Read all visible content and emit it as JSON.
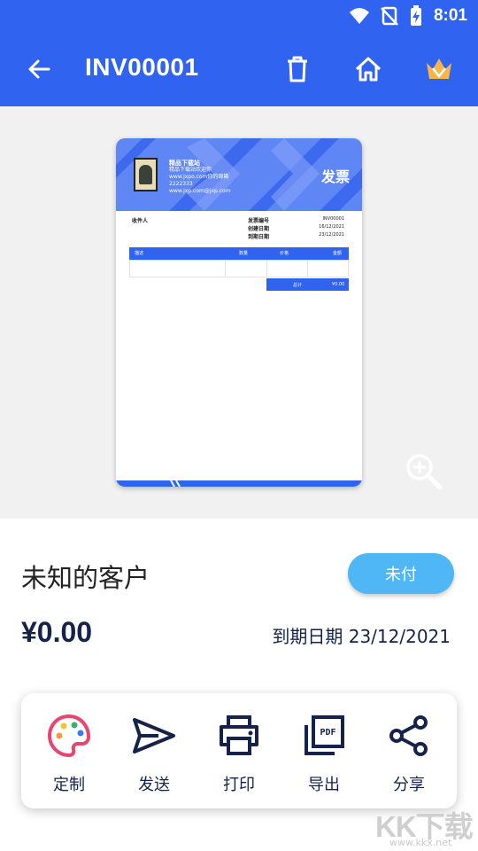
{
  "status": {
    "time": "8:01"
  },
  "appbar": {
    "title": "INV00001",
    "back_icon": "arrow-left-icon",
    "delete_icon": "trash-icon",
    "home_icon": "home-icon",
    "premium_icon": "crown-icon"
  },
  "invoice_preview": {
    "company_name": "精品下载站",
    "company_lines": [
      "精品下载站欢迎你",
      "www.jxpo.com你的邮箱",
      "2222333",
      "www.jxp.com@jxp.com"
    ],
    "doc_title": "发票",
    "recipient_label": "收件人",
    "meta": [
      {
        "label": "发票编号",
        "value": "INV00001"
      },
      {
        "label": "创建日期",
        "value": "16/12/2021"
      },
      {
        "label": "到期日期",
        "value": "23/12/2021"
      }
    ],
    "table_headers": [
      "描述",
      "数量",
      "价格",
      "金额"
    ],
    "total_label": "总计",
    "total_value": "¥0.00"
  },
  "summary": {
    "client": "未知的客户",
    "status": "未付",
    "amount": "¥0.00",
    "due_label": "到期日期",
    "due_date": "23/12/2021"
  },
  "actions": [
    {
      "label": "定制",
      "icon": "palette-icon"
    },
    {
      "label": "发送",
      "icon": "send-icon"
    },
    {
      "label": "打印",
      "icon": "printer-icon"
    },
    {
      "label": "导出",
      "icon": "pdf-icon"
    },
    {
      "label": "分享",
      "icon": "share-icon"
    }
  ],
  "watermark": {
    "text": "KK下载",
    "url": "www.kkx.net"
  },
  "colors": {
    "primary": "#2f63f0",
    "badge": "#4fb7f5",
    "dark_text": "#15234a",
    "preview_bg": "#f1f1f1"
  }
}
